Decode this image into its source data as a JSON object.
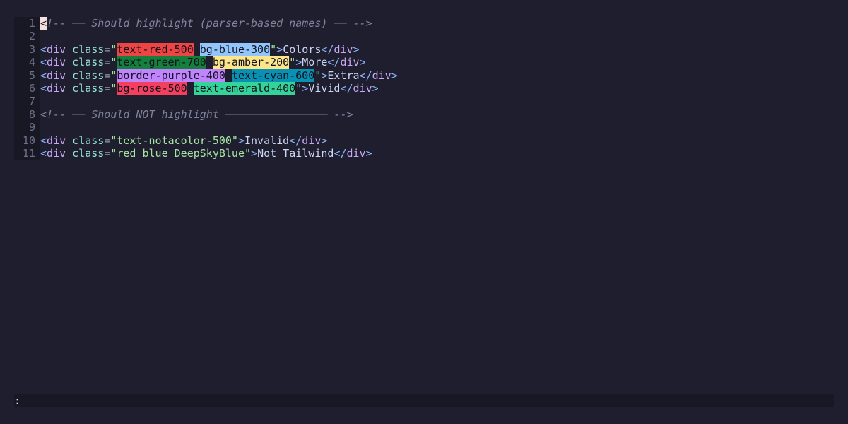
{
  "editor": {
    "lines": [
      {
        "num": "1",
        "tokens": [
          {
            "t": "<",
            "k": "cursor"
          },
          {
            "t": "!-- ── Should highlight (parser-based names) ── -->",
            "k": "comment"
          }
        ]
      },
      {
        "num": "2",
        "tokens": []
      },
      {
        "num": "3",
        "tokens": [
          {
            "t": "<",
            "k": "tag"
          },
          {
            "t": "div",
            "k": "tag-name"
          },
          {
            "t": " ",
            "k": "text"
          },
          {
            "t": "class",
            "k": "attr"
          },
          {
            "t": "=",
            "k": "punct"
          },
          {
            "t": "\"",
            "k": "str-delim"
          },
          {
            "t": "text-red-500",
            "k": "chip",
            "bg": "#ef4444"
          },
          {
            "t": " ",
            "k": "text"
          },
          {
            "t": "bg-blue-300",
            "k": "chip",
            "bg": "#93c5fd"
          },
          {
            "t": "\"",
            "k": "str-delim"
          },
          {
            "t": ">",
            "k": "tag"
          },
          {
            "t": "Colors",
            "k": "text"
          },
          {
            "t": "</",
            "k": "tag"
          },
          {
            "t": "div",
            "k": "tag-name"
          },
          {
            "t": ">",
            "k": "tag"
          }
        ]
      },
      {
        "num": "4",
        "tokens": [
          {
            "t": "<",
            "k": "tag"
          },
          {
            "t": "div",
            "k": "tag-name"
          },
          {
            "t": " ",
            "k": "text"
          },
          {
            "t": "class",
            "k": "attr"
          },
          {
            "t": "=",
            "k": "punct"
          },
          {
            "t": "\"",
            "k": "str-delim"
          },
          {
            "t": "text-green-700",
            "k": "chip",
            "bg": "#15803d"
          },
          {
            "t": " ",
            "k": "text"
          },
          {
            "t": "bg-amber-200",
            "k": "chip",
            "bg": "#fde68a"
          },
          {
            "t": "\"",
            "k": "str-delim"
          },
          {
            "t": ">",
            "k": "tag"
          },
          {
            "t": "More",
            "k": "text"
          },
          {
            "t": "</",
            "k": "tag"
          },
          {
            "t": "div",
            "k": "tag-name"
          },
          {
            "t": ">",
            "k": "tag"
          }
        ]
      },
      {
        "num": "5",
        "tokens": [
          {
            "t": "<",
            "k": "tag"
          },
          {
            "t": "div",
            "k": "tag-name"
          },
          {
            "t": " ",
            "k": "text"
          },
          {
            "t": "class",
            "k": "attr"
          },
          {
            "t": "=",
            "k": "punct"
          },
          {
            "t": "\"",
            "k": "str-delim"
          },
          {
            "t": "border-purple-400",
            "k": "chip",
            "bg": "#c084fc"
          },
          {
            "t": " ",
            "k": "text"
          },
          {
            "t": "text-cyan-600",
            "k": "chip",
            "bg": "#0891b2"
          },
          {
            "t": "\"",
            "k": "str-delim"
          },
          {
            "t": ">",
            "k": "tag"
          },
          {
            "t": "Extra",
            "k": "text"
          },
          {
            "t": "</",
            "k": "tag"
          },
          {
            "t": "div",
            "k": "tag-name"
          },
          {
            "t": ">",
            "k": "tag"
          }
        ]
      },
      {
        "num": "6",
        "tokens": [
          {
            "t": "<",
            "k": "tag"
          },
          {
            "t": "div",
            "k": "tag-name"
          },
          {
            "t": " ",
            "k": "text"
          },
          {
            "t": "class",
            "k": "attr"
          },
          {
            "t": "=",
            "k": "punct"
          },
          {
            "t": "\"",
            "k": "str-delim"
          },
          {
            "t": "bg-rose-500",
            "k": "chip",
            "bg": "#f43f5e"
          },
          {
            "t": " ",
            "k": "text"
          },
          {
            "t": "text-emerald-400",
            "k": "chip",
            "bg": "#34d399"
          },
          {
            "t": "\"",
            "k": "str-delim"
          },
          {
            "t": ">",
            "k": "tag"
          },
          {
            "t": "Vivid",
            "k": "text"
          },
          {
            "t": "</",
            "k": "tag"
          },
          {
            "t": "div",
            "k": "tag-name"
          },
          {
            "t": ">",
            "k": "tag"
          }
        ]
      },
      {
        "num": "7",
        "tokens": []
      },
      {
        "num": "8",
        "tokens": [
          {
            "t": "<!-- ── Should NOT highlight ──────────────── -->",
            "k": "comment"
          }
        ]
      },
      {
        "num": "9",
        "tokens": []
      },
      {
        "num": "10",
        "tokens": [
          {
            "t": "<",
            "k": "tag"
          },
          {
            "t": "div",
            "k": "tag-name"
          },
          {
            "t": " ",
            "k": "text"
          },
          {
            "t": "class",
            "k": "attr"
          },
          {
            "t": "=",
            "k": "punct"
          },
          {
            "t": "\"text-notacolor-500\"",
            "k": "str"
          },
          {
            "t": ">",
            "k": "tag"
          },
          {
            "t": "Invalid",
            "k": "text"
          },
          {
            "t": "</",
            "k": "tag"
          },
          {
            "t": "div",
            "k": "tag-name"
          },
          {
            "t": ">",
            "k": "tag"
          }
        ]
      },
      {
        "num": "11",
        "tokens": [
          {
            "t": "<",
            "k": "tag"
          },
          {
            "t": "div",
            "k": "tag-name"
          },
          {
            "t": " ",
            "k": "text"
          },
          {
            "t": "class",
            "k": "attr"
          },
          {
            "t": "=",
            "k": "punct"
          },
          {
            "t": "\"red blue DeepSkyBlue\"",
            "k": "str"
          },
          {
            "t": ">",
            "k": "tag"
          },
          {
            "t": "Not Tailwind",
            "k": "text"
          },
          {
            "t": "</",
            "k": "tag"
          },
          {
            "t": "div",
            "k": "tag-name"
          },
          {
            "t": ">",
            "k": "tag"
          }
        ]
      }
    ]
  },
  "statusline": {
    "command_prompt": ":"
  }
}
